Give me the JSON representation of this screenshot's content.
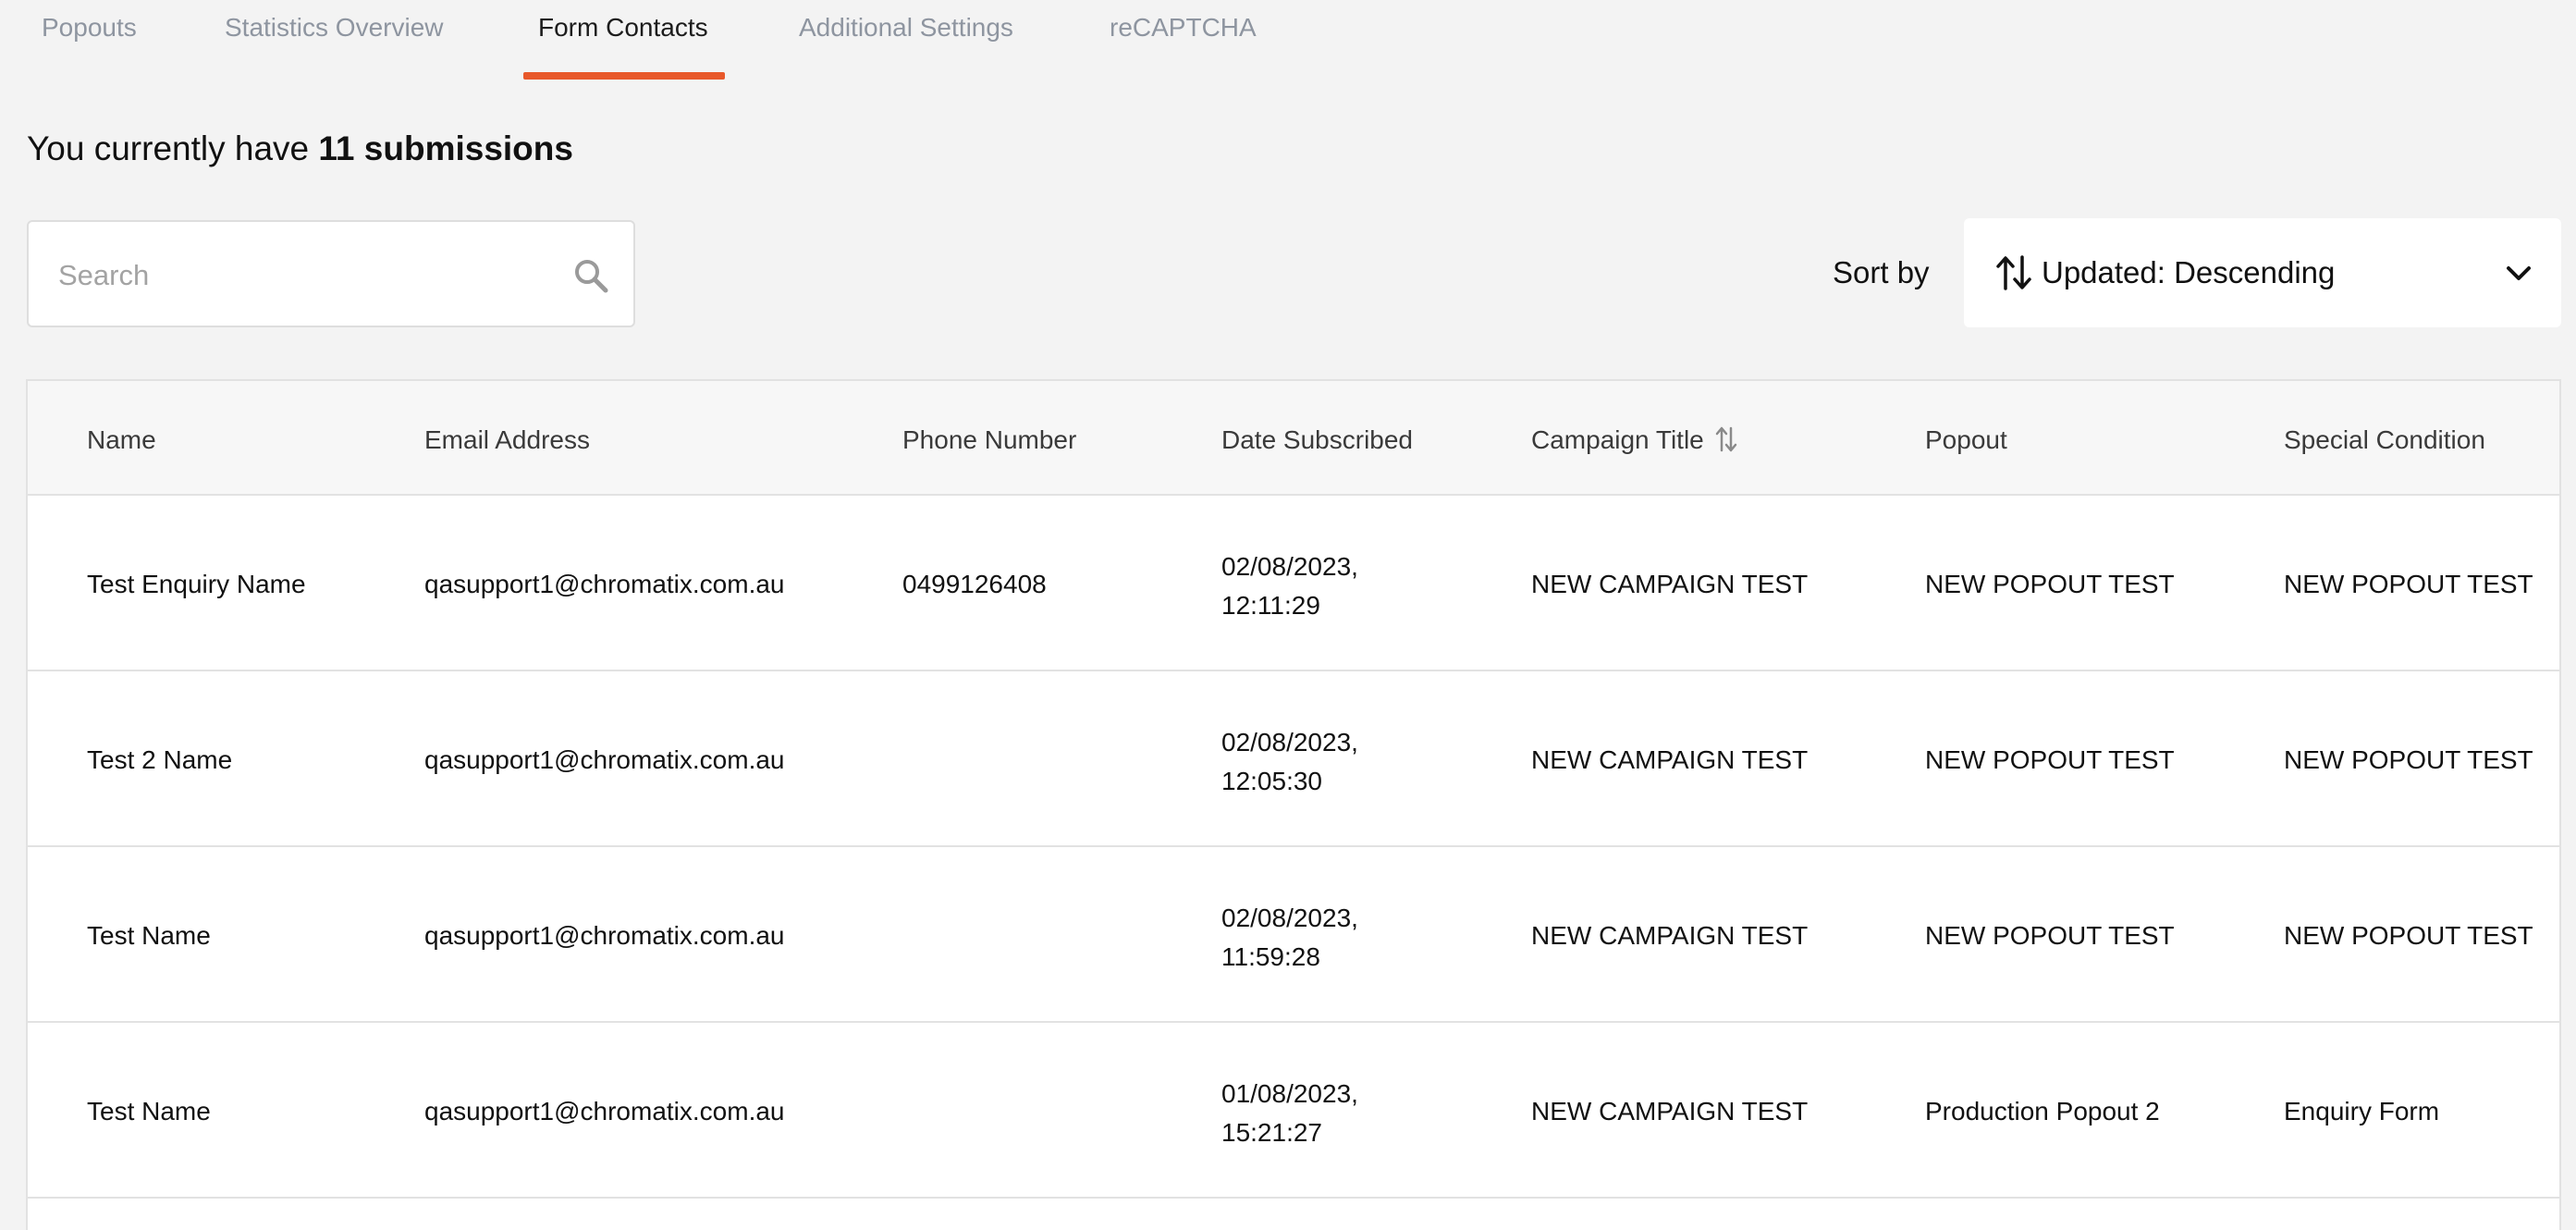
{
  "tabs": [
    {
      "label": "Popouts"
    },
    {
      "label": "Statistics Overview"
    },
    {
      "label": "Form Contacts"
    },
    {
      "label": "Additional Settings"
    },
    {
      "label": "reCAPTCHA"
    }
  ],
  "active_tab": "Form Contacts",
  "summary": {
    "prefix": "You currently have",
    "count_text": "11 submissions"
  },
  "search": {
    "placeholder": "Search",
    "value": ""
  },
  "sort": {
    "label": "Sort by",
    "value": "Updated: Descending"
  },
  "table": {
    "columns": [
      "Name",
      "Email Address",
      "Phone Number",
      "Date Subscribed",
      "Campaign Title",
      "Popout",
      "Special Condition"
    ],
    "rows": [
      {
        "name": "Test Enquiry Name",
        "email": "qasupport1@chromatix.com.au",
        "phone": "0499126408",
        "date": "02/08/2023,",
        "time": "12:11:29",
        "campaign": "NEW CAMPAIGN TEST",
        "popout": "NEW POPOUT TEST",
        "condition": "NEW POPOUT TEST"
      },
      {
        "name": "Test 2 Name",
        "email": "qasupport1@chromatix.com.au",
        "phone": "",
        "date": "02/08/2023,",
        "time": "12:05:30",
        "campaign": "NEW CAMPAIGN TEST",
        "popout": "NEW POPOUT TEST",
        "condition": "NEW POPOUT TEST"
      },
      {
        "name": "Test Name",
        "email": "qasupport1@chromatix.com.au",
        "phone": "",
        "date": "02/08/2023,",
        "time": "11:59:28",
        "campaign": "NEW CAMPAIGN TEST",
        "popout": "NEW POPOUT TEST",
        "condition": "NEW POPOUT TEST"
      },
      {
        "name": "Test Name",
        "email": "qasupport1@chromatix.com.au",
        "phone": "",
        "date": "01/08/2023,",
        "time": "15:21:27",
        "campaign": "NEW CAMPAIGN TEST",
        "popout": "Production Popout 2",
        "condition": "Enquiry Form"
      }
    ]
  },
  "colors": {
    "accent": "#e8582a",
    "background": "#f3f3f3",
    "inactive_tab": "#8e95a0"
  },
  "icons": {
    "search": "search-icon",
    "sort": "sort-arrows-icon",
    "dropdown": "chevron-down-icon",
    "column_sort": "sort-arrows-icon"
  }
}
